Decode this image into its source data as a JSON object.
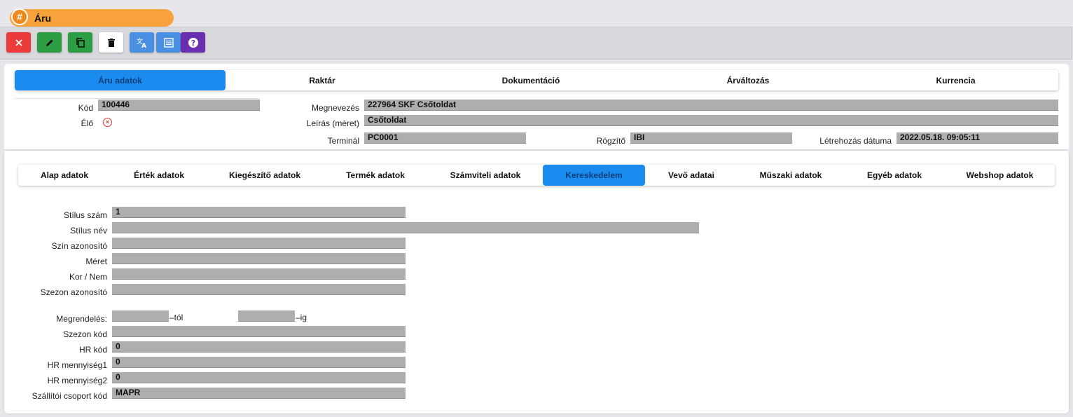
{
  "window": {
    "title": "Áru"
  },
  "toolbar": {
    "buttons": [
      {
        "name": "close",
        "color": "#ec3b3b"
      },
      {
        "name": "edit",
        "color": "#2e9e44"
      },
      {
        "name": "copy",
        "color": "#2e9e44"
      },
      {
        "name": "delete",
        "color": "#ffffff"
      },
      {
        "name": "translate",
        "color": "#4a90e2"
      },
      {
        "name": "list",
        "color": "#4a90e2"
      },
      {
        "name": "help",
        "color": "#6a2fb0"
      }
    ]
  },
  "main_tabs": [
    "Áru adatok",
    "Raktár",
    "Dokumentáció",
    "Árváltozás",
    "Kurrencia"
  ],
  "main_tab_active": "Áru adatok",
  "header": {
    "kod_label": "Kód",
    "kod_value": "100446",
    "elo_label": "Élő",
    "megnevezes_label": "Megnevezés",
    "megnevezes_value": "227964 SKF Csőtoldat",
    "leiras_label": "Leírás (méret)",
    "leiras_value": "Csőtoldat",
    "terminal_label": "Terminál",
    "terminal_value": "PC0001",
    "rogzito_label": "Rögzítő",
    "rogzito_value": "IBI",
    "letrehozas_label": "Létrehozás dátuma",
    "letrehozas_value": "2022.05.18. 09:05:11"
  },
  "sub_tabs": [
    "Alap adatok",
    "Érték adatok",
    "Kiegészítő adatok",
    "Termék adatok",
    "Számviteli adatok",
    "Kereskedelem",
    "Vevő adatai",
    "Műszaki adatok",
    "Egyéb adatok",
    "Webshop adatok"
  ],
  "sub_tab_active": "Kereskedelem",
  "form": {
    "stilus_szam_label": "Stílus szám",
    "stilus_szam_value": "1",
    "stilus_nev_label": "Stílus név",
    "stilus_nev_value": "",
    "szin_label": "Szín azonosító",
    "szin_value": "",
    "meret_label": "Méret",
    "meret_value": "",
    "kor_label": "Kor / Nem",
    "kor_value": "",
    "szezon_az_label": "Szezon azonosító",
    "szezon_az_value": "",
    "megrendeles_label": "Megrendelés:",
    "tol_suffix": "–tól",
    "ig_suffix": "–ig",
    "szezon_kod_label": "Szezon kód",
    "szezon_kod_value": "",
    "hr_kod_label": "HR kód",
    "hr_kod_value": "0",
    "hr_menny1_label": "HR mennyiség1",
    "hr_menny1_value": "0",
    "hr_menny2_label": "HR mennyiség2",
    "hr_menny2_value": "0",
    "szall_label": "Szállítói csoport kód",
    "szall_value": "MAPR"
  }
}
